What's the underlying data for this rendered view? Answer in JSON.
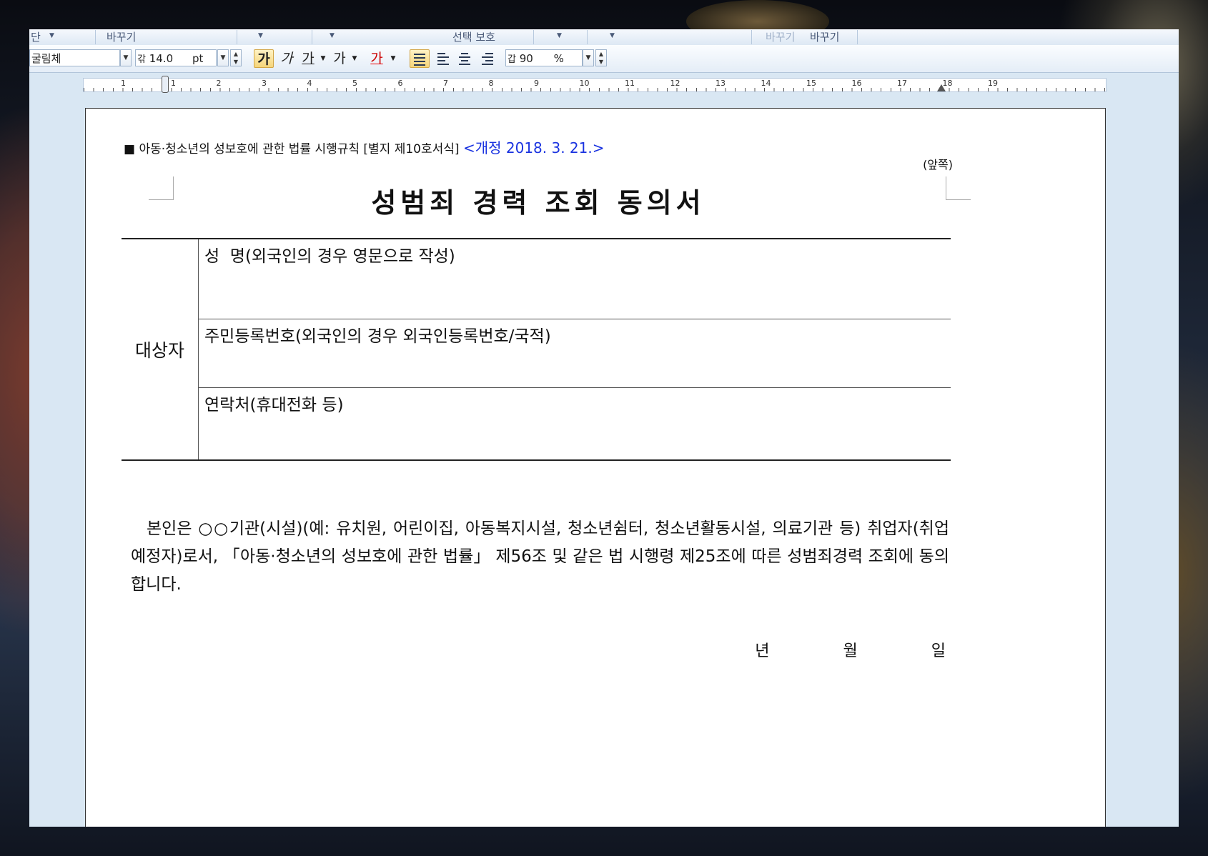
{
  "toolbar_top": {
    "items": [
      "단",
      "바꾸기",
      "선택 보호",
      "바꾸기",
      "바꾸기"
    ]
  },
  "format_bar": {
    "font_name": "굴림체",
    "font_size_prefix": "갂",
    "font_size": "14.0",
    "font_unit": "pt",
    "bold": "가",
    "italic": "가",
    "underline": "가",
    "strike": "가",
    "color": "가",
    "line_spacing_prefix": "갑",
    "line_spacing": "90",
    "line_spacing_unit": "%"
  },
  "ruler": {
    "numbers": [
      "1",
      "1",
      "2",
      "3",
      "4",
      "5",
      "6",
      "7",
      "8",
      "9",
      "10",
      "11",
      "12",
      "13",
      "14",
      "15",
      "16",
      "17",
      "18",
      "19"
    ]
  },
  "document": {
    "header_prefix": "■ 아동·청소년의 성보호에 관한 법률 시행규칙 [별지 제10호서식] ",
    "header_revision": "<개정 2018. 3. 21.>",
    "front_label": "(앞쪽)",
    "title": "성범죄 경력 조회 동의서",
    "subject_label": "대상자",
    "fields": [
      "성  명(외국인의 경우 영문으로 작성)",
      "주민등록번호(외국인의 경우 외국인등록번호/국적)",
      "연락처(휴대전화 등)"
    ],
    "paragraph": "본인은 ○○기관(시설)(예: 유치원, 어린이집, 아동복지시설, 청소년쉼터, 청소년활동시설, 의료기관 등) 취업자(취업예정자)로서, 「아동·청소년의 성보호에 관한 법률」 제56조 및 같은 법 시행령 제25조에 따른 성범죄경력 조회에 동의합니다.",
    "date_year": "년",
    "date_month": "월",
    "date_day": "일"
  }
}
